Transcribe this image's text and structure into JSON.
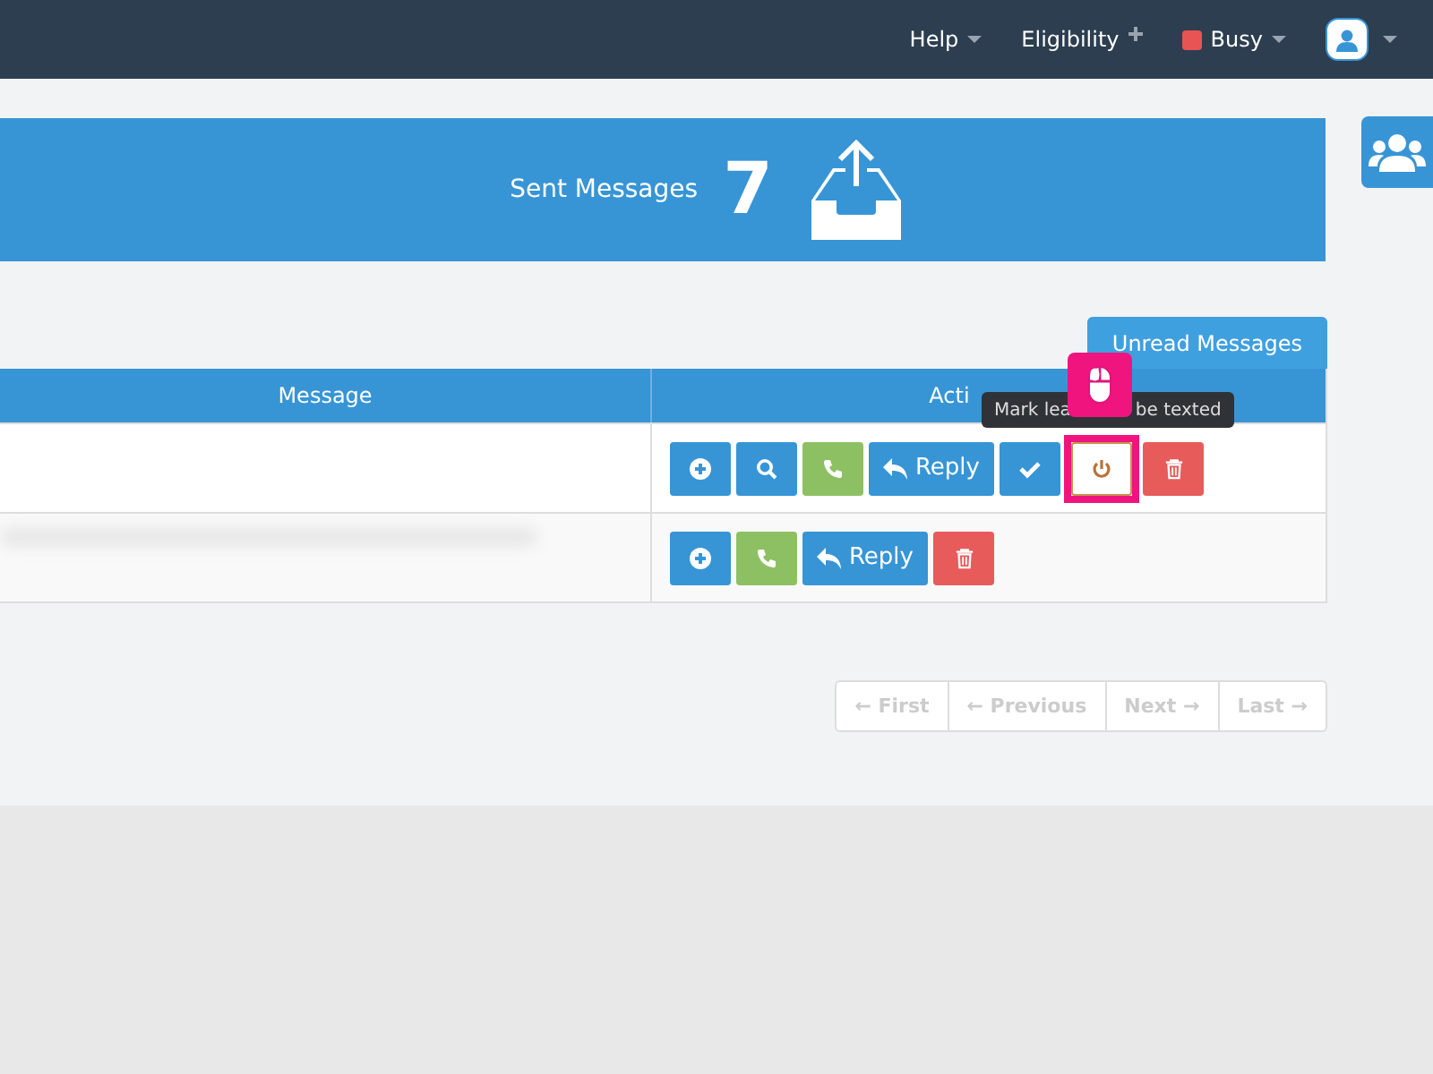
{
  "navbar": {
    "items": [
      {
        "label": "Help",
        "kind": "menu"
      },
      {
        "label": "Eligibility",
        "kind": "add"
      }
    ],
    "status": {
      "label": "Busy",
      "color": "#e85454"
    }
  },
  "banner": {
    "title": "Sent Messages",
    "count": "7"
  },
  "unread_button": "Unread Messages",
  "table": {
    "columns": [
      "Message",
      "Acti"
    ],
    "rows": [
      {
        "blurred": false,
        "actions": [
          {
            "kind": "add",
            "annotated": false
          },
          {
            "kind": "search",
            "annotated": false
          },
          {
            "kind": "call",
            "annotated": false
          },
          {
            "kind": "reply",
            "label": "Reply",
            "annotated": false
          },
          {
            "kind": "done",
            "annotated": false
          },
          {
            "kind": "mark",
            "annotated": true
          },
          {
            "kind": "delete",
            "annotated": false
          }
        ],
        "tooltip": {
          "left": "Mark lea",
          "right": "be texted"
        }
      },
      {
        "blurred": true,
        "actions": [
          {
            "kind": "add",
            "annotated": false
          },
          {
            "kind": "call",
            "annotated": false
          },
          {
            "kind": "reply",
            "label": "Reply",
            "annotated": false
          },
          {
            "kind": "delete",
            "annotated": false
          }
        ]
      }
    ]
  },
  "pagination": [
    "← First",
    "← Previous",
    "Next →",
    "Last →"
  ]
}
